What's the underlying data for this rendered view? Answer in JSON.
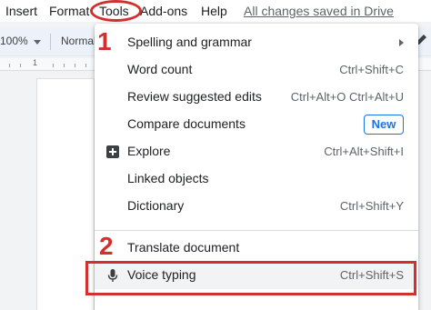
{
  "menubar": {
    "items": [
      "Insert",
      "Format",
      "Add-ons",
      "Help"
    ],
    "tools_label": "Tools",
    "saved_status": "All changes saved in Drive"
  },
  "toolbar": {
    "zoom": "100%",
    "style": "Normal"
  },
  "ruler": {
    "number": "1"
  },
  "annotations": {
    "step1": "1",
    "step2": "2"
  },
  "tools_menu": {
    "items": [
      {
        "label": "Spelling and grammar",
        "shortcut": "",
        "submenu": true
      },
      {
        "label": "Word count",
        "shortcut": "Ctrl+Shift+C"
      },
      {
        "label": "Review suggested edits",
        "shortcut": "Ctrl+Alt+O Ctrl+Alt+U"
      },
      {
        "label": "Compare documents",
        "badge": "New"
      },
      {
        "label": "Explore",
        "shortcut": "Ctrl+Alt+Shift+I",
        "icon": "explore-plus-icon"
      },
      {
        "label": "Linked objects",
        "shortcut": ""
      },
      {
        "label": "Dictionary",
        "shortcut": "Ctrl+Shift+Y"
      },
      {
        "label": "Translate document",
        "shortcut": ""
      },
      {
        "label": "Voice typing",
        "shortcut": "Ctrl+Shift+S",
        "icon": "microphone-icon",
        "highlighted": true
      }
    ]
  },
  "colors": {
    "annotation_red": "#d32f2f",
    "badge_blue": "#1a73e8"
  }
}
